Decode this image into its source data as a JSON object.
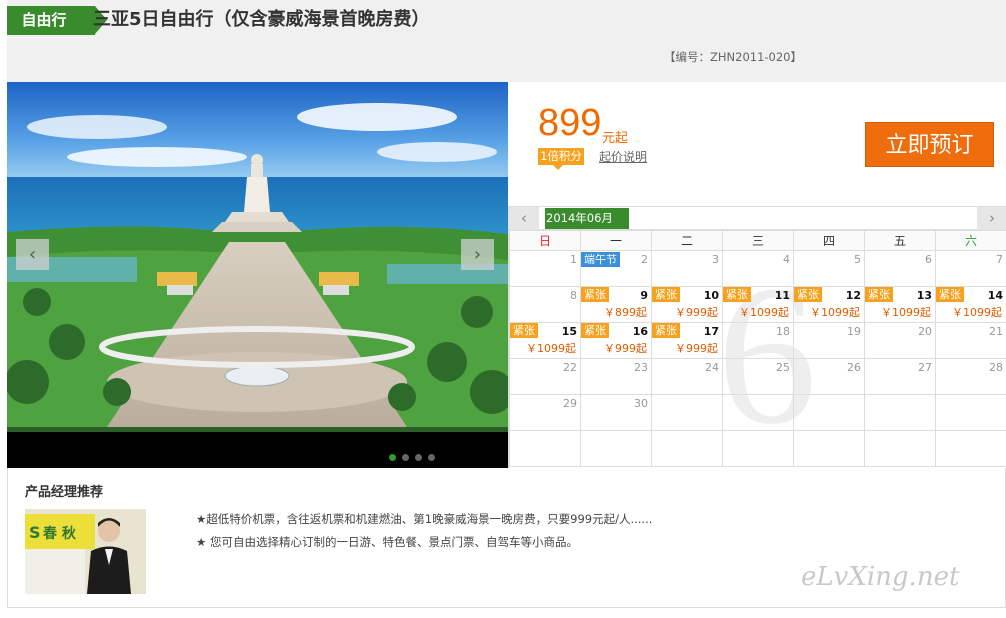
{
  "header": {
    "tag": "自由行",
    "title": "三亚5日自由行（仅含豪威海景首晚房费）",
    "product_code": "【编号：ZHN2011-020】"
  },
  "carousel": {
    "prev_icon": "chevron-left-icon",
    "next_icon": "chevron-right-icon",
    "prev_glyph": "‹",
    "next_glyph": "›",
    "dots": 4,
    "active_dot": 0
  },
  "pricing": {
    "price": "899",
    "price_unit": "元起",
    "points_badge": "1倍积分",
    "price_note": "起价说明",
    "book_button": "立即预订"
  },
  "calendar": {
    "prev_glyph": "‹",
    "next_glyph": "›",
    "month_label": "2014年06月",
    "month_watermark": "6",
    "weekdays": [
      "日",
      "一",
      "二",
      "三",
      "四",
      "五",
      "六"
    ],
    "tight_label": "紧张",
    "holiday_label": "端午节",
    "weeks": [
      [
        {
          "d": "1"
        },
        {
          "d": "2",
          "holiday": true
        },
        {
          "d": "3"
        },
        {
          "d": "4"
        },
        {
          "d": "5"
        },
        {
          "d": "6"
        },
        {
          "d": "7"
        }
      ],
      [
        {
          "d": "8"
        },
        {
          "d": "9",
          "tight": true,
          "price": "￥899起"
        },
        {
          "d": "10",
          "tight": true,
          "price": "￥999起"
        },
        {
          "d": "11",
          "tight": true,
          "price": "￥1099起"
        },
        {
          "d": "12",
          "tight": true,
          "price": "￥1099起"
        },
        {
          "d": "13",
          "tight": true,
          "price": "￥1099起"
        },
        {
          "d": "14",
          "tight": true,
          "price": "￥1099起"
        }
      ],
      [
        {
          "d": "15",
          "tight": true,
          "price": "￥1099起"
        },
        {
          "d": "16",
          "tight": true,
          "price": "￥999起"
        },
        {
          "d": "17",
          "tight": true,
          "price": "￥999起"
        },
        {
          "d": "18"
        },
        {
          "d": "19"
        },
        {
          "d": "20"
        },
        {
          "d": "21"
        }
      ],
      [
        {
          "d": "22"
        },
        {
          "d": "23"
        },
        {
          "d": "24"
        },
        {
          "d": "25"
        },
        {
          "d": "26"
        },
        {
          "d": "27"
        },
        {
          "d": "28"
        }
      ],
      [
        {
          "d": "29"
        },
        {
          "d": "30"
        },
        {
          "d": ""
        },
        {
          "d": ""
        },
        {
          "d": ""
        },
        {
          "d": ""
        },
        {
          "d": ""
        }
      ],
      [
        {
          "d": ""
        },
        {
          "d": ""
        },
        {
          "d": ""
        },
        {
          "d": ""
        },
        {
          "d": ""
        },
        {
          "d": ""
        },
        {
          "d": ""
        }
      ]
    ]
  },
  "manager": {
    "title": "产品经理推荐",
    "photo_logo_text": "春 秋",
    "lines": [
      "★超低特价机票，含往返机票和机建燃油、第1晚豪威海景一晚房费，只要999元起/人......",
      "★ 您可自由选择精心订制的一日游、特色餐、景点门票、自驾车等小商品。"
    ]
  },
  "watermark": "eLvXing.net",
  "colors": {
    "brand_green": "#3a8b2e",
    "price_orange": "#f06a00",
    "button_orange": "#ef6d0d",
    "tight_badge": "#f6a21f",
    "holiday_badge": "#3b8fd9"
  }
}
